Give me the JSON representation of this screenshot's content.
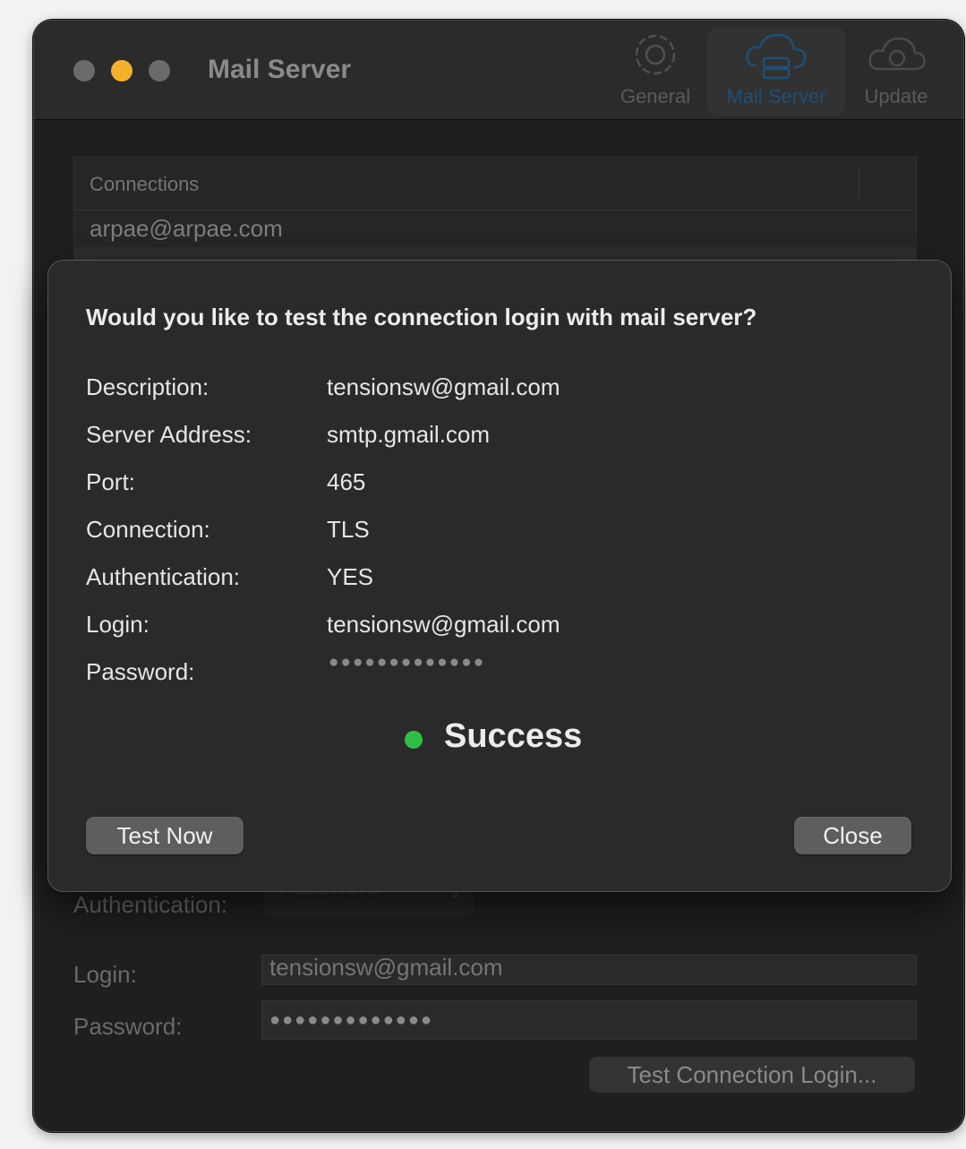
{
  "window": {
    "title": "Mail Server",
    "traffic_lights": {
      "close": "#6b6b6b",
      "minimize": "#f5b12c",
      "zoom": "#6b6b6b"
    },
    "toolbar": [
      {
        "label": "General",
        "icon": "gear-icon",
        "active": false
      },
      {
        "label": "Mail Server",
        "icon": "cloud-server-icon",
        "active": true
      },
      {
        "label": "Update",
        "icon": "cloud-sync-icon",
        "active": false
      }
    ]
  },
  "connections": {
    "header": "Connections",
    "rows": [
      "arpae@arpae.com"
    ]
  },
  "background_form": {
    "authentication_label": "Authentication:",
    "authentication_value": "Password",
    "login_label": "Login:",
    "login_value": "tensionsw@gmail.com",
    "password_label": "Password:",
    "password_value": "●●●●●●●●●●●●●",
    "test_button": "Test Connection Login..."
  },
  "sheet": {
    "question": "Would you like to test the connection login with mail server?",
    "fields": [
      {
        "label": "Description:",
        "value": "tensionsw@gmail.com"
      },
      {
        "label": "Server Address:",
        "value": "smtp.gmail.com"
      },
      {
        "label": "Port:",
        "value": "465"
      },
      {
        "label": "Connection:",
        "value": "TLS"
      },
      {
        "label": "Authentication:",
        "value": "YES"
      },
      {
        "label": "Login:",
        "value": "tensionsw@gmail.com"
      },
      {
        "label": "Password:",
        "value": "●●●●●●●●●●●●●"
      }
    ],
    "status": {
      "text": "Success",
      "color": "#2fbf45"
    },
    "test_button": "Test Now",
    "close_button": "Close"
  }
}
